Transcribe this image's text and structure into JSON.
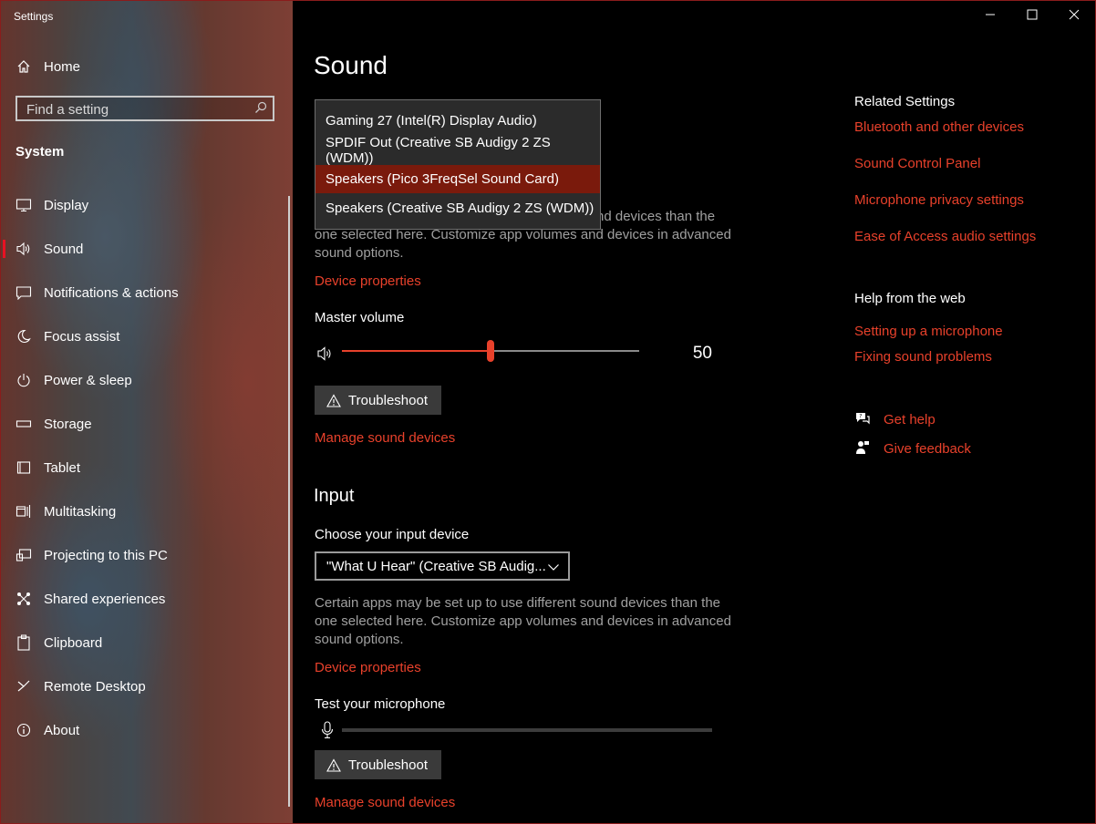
{
  "app": {
    "title": "Settings"
  },
  "window": {
    "minimize": "minimize",
    "maximize": "maximize",
    "close": "close"
  },
  "sidebar": {
    "home": {
      "label": "Home",
      "icon": "home-icon"
    },
    "search": {
      "placeholder": "Find a setting",
      "value": ""
    },
    "section": "System",
    "items": [
      {
        "label": "Display",
        "icon": "display-icon"
      },
      {
        "label": "Sound",
        "icon": "speaker-icon",
        "active": true
      },
      {
        "label": "Notifications & actions",
        "icon": "notifications-icon"
      },
      {
        "label": "Focus assist",
        "icon": "moon-icon"
      },
      {
        "label": "Power & sleep",
        "icon": "power-icon"
      },
      {
        "label": "Storage",
        "icon": "storage-icon"
      },
      {
        "label": "Tablet",
        "icon": "tablet-icon"
      },
      {
        "label": "Multitasking",
        "icon": "multitasking-icon"
      },
      {
        "label": "Projecting to this PC",
        "icon": "projecting-icon"
      },
      {
        "label": "Shared experiences",
        "icon": "shared-icon"
      },
      {
        "label": "Clipboard",
        "icon": "clipboard-icon"
      },
      {
        "label": "Remote Desktop",
        "icon": "remote-desktop-icon"
      },
      {
        "label": "About",
        "icon": "info-icon"
      }
    ]
  },
  "main": {
    "title": "Sound",
    "output": {
      "dropdown_options": [
        "Gaming 27 (Intel(R) Display Audio)",
        "SPDIF Out (Creative SB Audigy 2 ZS (WDM))",
        "Speakers (Pico 3FreqSel Sound Card)",
        "Speakers (Creative SB Audigy 2 ZS (WDM))"
      ],
      "selected_index": 2,
      "desc_line1": "nd devices than the",
      "desc_line2": "one selected here. Customize app volumes and devices in advanced",
      "desc_line3": "sound options.",
      "device_properties": "Device properties",
      "master_volume_label": "Master volume",
      "volume": 50,
      "volume_text": "50",
      "troubleshoot": "Troubleshoot",
      "manage": "Manage sound devices"
    },
    "input": {
      "heading": "Input",
      "choose_label": "Choose your input device",
      "selected_device": "\"What U Hear\" (Creative SB Audig...",
      "desc_line1": "Certain apps may be set up to use different sound devices than the",
      "desc_line2": "one selected here. Customize app volumes and devices in advanced",
      "desc_line3": "sound options.",
      "device_properties": "Device properties",
      "test_label": "Test your microphone",
      "mic_level": 0,
      "troubleshoot": "Troubleshoot",
      "manage": "Manage sound devices"
    }
  },
  "related": {
    "heading": "Related Settings",
    "links": [
      "Bluetooth and other devices",
      "Sound Control Panel",
      "Microphone privacy settings",
      "Ease of Access audio settings"
    ],
    "help_heading": "Help from the web",
    "help_links": [
      "Setting up a microphone",
      "Fixing sound problems"
    ],
    "get_help": "Get help",
    "give_feedback": "Give feedback"
  },
  "colors": {
    "accent": "#e8412b",
    "selection": "#7a1a0c",
    "background": "#000000"
  }
}
